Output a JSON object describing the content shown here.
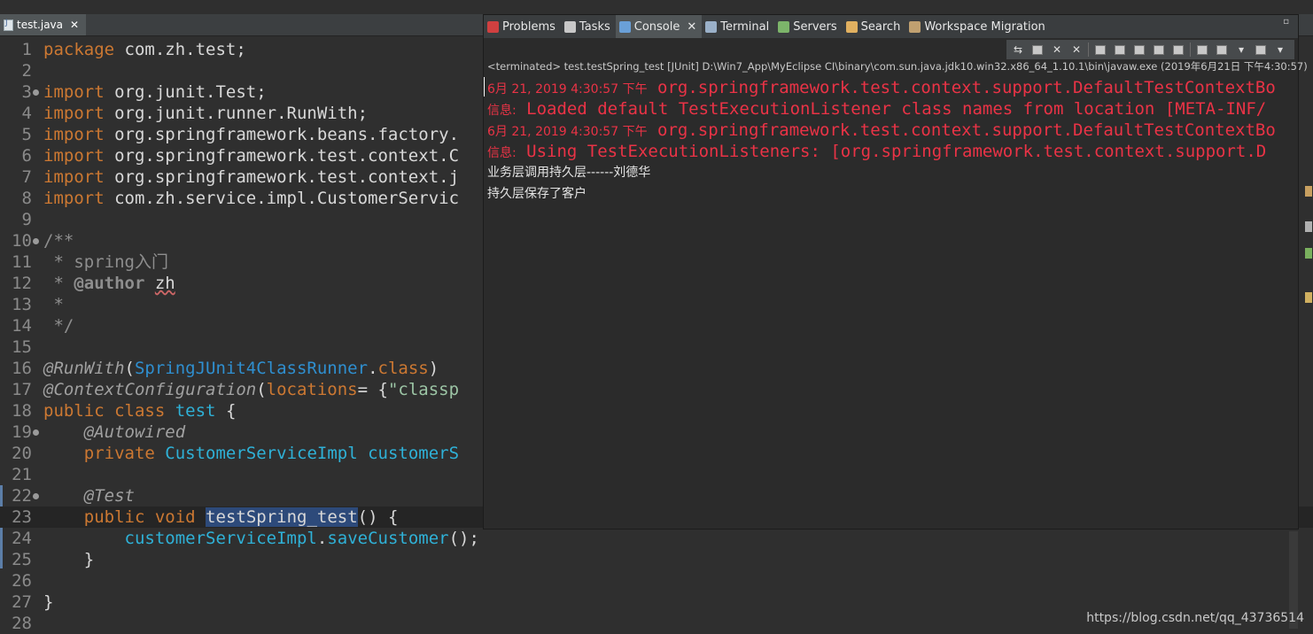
{
  "editor": {
    "tab_label": "test.java",
    "tab_close": "✕",
    "lines": [
      {
        "n": "1",
        "segs": [
          [
            "kw",
            "package"
          ],
          [
            "t",
            " com.zh.test;"
          ]
        ]
      },
      {
        "n": "2",
        "segs": []
      },
      {
        "n": "3",
        "fold": true,
        "segs": [
          [
            "kw",
            "import"
          ],
          [
            "t",
            " org.junit.Test;"
          ]
        ]
      },
      {
        "n": "4",
        "segs": [
          [
            "kw",
            "import"
          ],
          [
            "t",
            " org.junit.runner.RunWith;"
          ]
        ]
      },
      {
        "n": "5",
        "segs": [
          [
            "kw",
            "import"
          ],
          [
            "t",
            " org.springframework.beans.factory."
          ]
        ]
      },
      {
        "n": "6",
        "segs": [
          [
            "kw",
            "import"
          ],
          [
            "t",
            " org.springframework.test.context.C"
          ]
        ]
      },
      {
        "n": "7",
        "segs": [
          [
            "kw",
            "import"
          ],
          [
            "t",
            " org.springframework.test.context.j"
          ]
        ]
      },
      {
        "n": "8",
        "segs": [
          [
            "kw",
            "import"
          ],
          [
            "t",
            " com.zh.service.impl.CustomerServic"
          ]
        ]
      },
      {
        "n": "9",
        "segs": []
      },
      {
        "n": "10",
        "fold": true,
        "segs": [
          [
            "cm",
            "/**"
          ]
        ]
      },
      {
        "n": "11",
        "segs": [
          [
            "cm",
            " * spring入门"
          ]
        ]
      },
      {
        "n": "12",
        "segs": [
          [
            "cm",
            " * "
          ],
          [
            "cmtag",
            "@author"
          ],
          [
            "cm",
            " "
          ],
          [
            "squig",
            "zh"
          ]
        ]
      },
      {
        "n": "13",
        "segs": [
          [
            "cm",
            " *"
          ]
        ]
      },
      {
        "n": "14",
        "segs": [
          [
            "cm",
            " */"
          ]
        ]
      },
      {
        "n": "15",
        "segs": []
      },
      {
        "n": "16",
        "segs": [
          [
            "an",
            "@RunWith"
          ],
          [
            "t",
            "("
          ],
          [
            "cls",
            "SpringJUnit4ClassRunner"
          ],
          [
            "t",
            "."
          ],
          [
            "kw",
            "class"
          ],
          [
            "t",
            ")"
          ]
        ]
      },
      {
        "n": "17",
        "segs": [
          [
            "an",
            "@ContextConfiguration"
          ],
          [
            "t",
            "("
          ],
          [
            "kw",
            "locations"
          ],
          [
            "t",
            "= {"
          ],
          [
            "str",
            "\"classp"
          ]
        ]
      },
      {
        "n": "18",
        "segs": [
          [
            "kw",
            "public class"
          ],
          [
            "t",
            " "
          ],
          [
            "fld",
            "test"
          ],
          [
            "t",
            " {"
          ]
        ]
      },
      {
        "n": "19",
        "fold": true,
        "segs": [
          [
            "t",
            "    "
          ],
          [
            "an",
            "@Autowired"
          ]
        ]
      },
      {
        "n": "20",
        "segs": [
          [
            "t",
            "    "
          ],
          [
            "kw",
            "private"
          ],
          [
            "t",
            " "
          ],
          [
            "fld",
            "CustomerServiceImpl"
          ],
          [
            "t",
            " "
          ],
          [
            "fld",
            "customerS"
          ]
        ]
      },
      {
        "n": "21",
        "segs": []
      },
      {
        "n": "22",
        "fold": true,
        "segs": [
          [
            "t",
            "    "
          ],
          [
            "an",
            "@Test"
          ]
        ]
      },
      {
        "n": "23",
        "cur": true,
        "segs": [
          [
            "t",
            "    "
          ],
          [
            "kw",
            "public void"
          ],
          [
            "t",
            " "
          ],
          [
            "sel",
            "testSpring_test"
          ],
          [
            "t",
            "() {"
          ]
        ]
      },
      {
        "n": "24",
        "segs": [
          [
            "t",
            "        "
          ],
          [
            "fld",
            "customerServiceImpl"
          ],
          [
            "t",
            "."
          ],
          [
            "fld",
            "saveCustomer"
          ],
          [
            "t",
            "();"
          ]
        ]
      },
      {
        "n": "25",
        "segs": [
          [
            "t",
            "    }"
          ]
        ]
      },
      {
        "n": "26",
        "segs": []
      },
      {
        "n": "27",
        "segs": [
          [
            "t",
            "}"
          ]
        ]
      },
      {
        "n": "28",
        "segs": []
      }
    ]
  },
  "console_view": {
    "tabs": [
      {
        "label": "Problems",
        "icon": "problems-icon",
        "color": "#d04040"
      },
      {
        "label": "Tasks",
        "icon": "tasks-icon",
        "color": "#c8c8c8"
      },
      {
        "label": "Console",
        "icon": "console-icon",
        "color": "#6aa0d8",
        "active": true
      },
      {
        "label": "Terminal",
        "icon": "terminal-icon",
        "color": "#9ab0c8"
      },
      {
        "label": "Servers",
        "icon": "servers-icon",
        "color": "#7cb46a"
      },
      {
        "label": "Search",
        "icon": "search-icon",
        "color": "#e0b060"
      },
      {
        "label": "Workspace Migration",
        "icon": "migration-icon",
        "color": "#c0a070"
      }
    ],
    "active_close": "✕",
    "minimize_glyph": "▫",
    "status": "<terminated> test.testSpring_test [JUnit] D:\\Win7_App\\MyEclipse CI\\binary\\com.sun.java.jdk10.win32.x86_64_1.10.1\\bin\\javaw.exe (2019年6月21日 下午4:30:57)",
    "output": [
      {
        "type": "err",
        "ts": "6月 21, 2019 4:30:57 下午",
        "msg": " org.springframework.test.context.support.DefaultTestContextBo"
      },
      {
        "type": "err",
        "ts": "信息:",
        "msg": " Loaded default TestExecutionListener class names from location [META-INF/"
      },
      {
        "type": "err",
        "ts": "6月 21, 2019 4:30:57 下午",
        "msg": " org.springframework.test.context.support.DefaultTestContextBo"
      },
      {
        "type": "err",
        "ts": "信息:",
        "msg": " Using TestExecutionListeners: [org.springframework.test.context.support.D"
      },
      {
        "type": "out",
        "text": "业务层调用持久层------刘德华"
      },
      {
        "type": "out",
        "text": "持久层保存了客户"
      }
    ]
  },
  "watermark": "https://blog.csdn.net/qq_43736514"
}
